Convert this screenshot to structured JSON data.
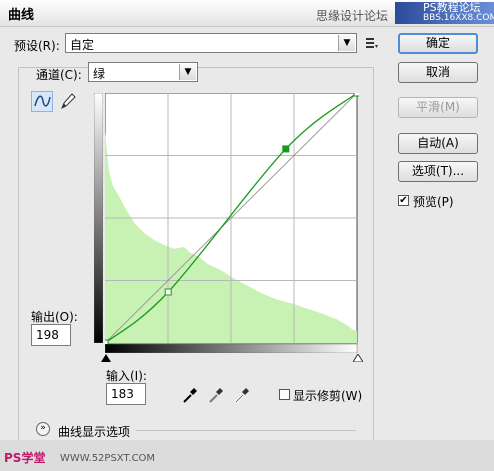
{
  "dialog": {
    "title": "曲线"
  },
  "watermark": {
    "text": "思缘设计论坛",
    "logo_line1": "PS教程论坛",
    "logo_line2": "BBS.16XX8.COM"
  },
  "preset": {
    "label": "预设(R):",
    "value": "自定"
  },
  "channel": {
    "label": "通道(C):",
    "value": "绿"
  },
  "output": {
    "label": "输出(O):",
    "value": "198"
  },
  "input": {
    "label": "输入(I):",
    "value": "183"
  },
  "buttons": {
    "ok": "确定",
    "cancel": "取消",
    "smooth": "平滑(M)",
    "auto": "自动(A)",
    "options": "选项(T)...",
    "preview": "预览(P)"
  },
  "show_clipping": {
    "label": "显示修剪(W)"
  },
  "curve_display": {
    "label": "曲线显示选项"
  },
  "footer": {
    "left": "PS学堂",
    "url": "WWW.52PSXT.COM"
  },
  "colors": {
    "curve": "#1a9a1a",
    "histogram": "#c8f2b4",
    "accent": "#4d8ed6"
  },
  "chart_data": {
    "type": "line",
    "xlim": [
      0,
      255
    ],
    "ylim": [
      0,
      255
    ],
    "grid_divisions": 4,
    "series": [
      {
        "values_x": [
          0,
          64,
          183,
          255
        ],
        "values_y": [
          0,
          52,
          198,
          255
        ]
      }
    ],
    "histogram": [
      [
        0,
        215
      ],
      [
        4,
        175
      ],
      [
        8,
        160
      ],
      [
        14,
        150
      ],
      [
        22,
        135
      ],
      [
        30,
        122
      ],
      [
        40,
        112
      ],
      [
        50,
        105
      ],
      [
        60,
        100
      ],
      [
        70,
        96
      ],
      [
        80,
        98
      ],
      [
        86,
        92
      ],
      [
        95,
        88
      ],
      [
        105,
        80
      ],
      [
        118,
        74
      ],
      [
        130,
        66
      ],
      [
        145,
        58
      ],
      [
        160,
        50
      ],
      [
        175,
        44
      ],
      [
        190,
        40
      ],
      [
        205,
        35
      ],
      [
        220,
        30
      ],
      [
        235,
        24
      ],
      [
        245,
        18
      ],
      [
        250,
        14
      ],
      [
        255,
        12
      ]
    ]
  }
}
